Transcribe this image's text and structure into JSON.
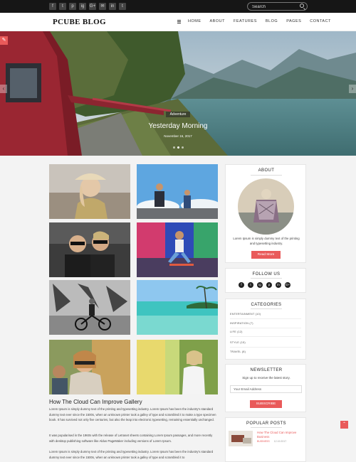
{
  "topbar": {
    "social": [
      "f",
      "t",
      "p",
      "ig",
      "G+",
      "✉",
      "in",
      "t"
    ],
    "search_placeholder": "Search"
  },
  "header": {
    "logo": "PCUBE BLOG",
    "nav": [
      "HOME",
      "ABOUT",
      "FEATURES",
      "BLOG",
      "PAGES",
      "CONTACT"
    ]
  },
  "hero": {
    "category": "Adventure",
    "title": "Yesterday Morning",
    "date": "November 16, 2017"
  },
  "post": {
    "title": "How The Cloud Can Improve Gallery",
    "para1": "Lorem Ipsum is simply dummy text of the printing and typesetting industry. Lorem Ipsum has been the industry's standard dummy text ever since the 1500s, when an unknown printer took a galley of type and scrambled it to make a type specimen book. It has survived not only five centuries, but also the leap into electronic typesetting, remaining essentially unchanged.",
    "para2": "It was popularised in the 1960s with the release of Letraset sheets containing Lorem Ipsum passages, and more recently with desktop publishing software like Aldus PageMaker including versions of Lorem Ipsum.",
    "para3": "Lorem Ipsum is simply dummy text of the printing and typesetting industry. Lorem Ipsum has been the industry's standard dummy text ever since the 1500s, when an unknown printer took a galley of type and scrambled it to"
  },
  "sidebar": {
    "about": {
      "title": "ABOUT",
      "text": "Lorem Ipsum is simply dummy text of the printing and typesetting industry.",
      "button": "Read More"
    },
    "follow": {
      "title": "FOLLOW US",
      "icons": [
        "f",
        "t",
        "ig",
        "p",
        "in",
        "G+"
      ]
    },
    "categories": {
      "title": "CATEGORIES",
      "items": [
        "ENTERTAINMENT (10)",
        "INSPIRATION (7)",
        "LIFE (12)",
        "STYLE (15)",
        "TRAVEL (8)"
      ]
    },
    "newsletter": {
      "title": "NEWSLETTER",
      "text": "Sign up to receive the latest story.",
      "placeholder": "Your Email Address",
      "button": "SUBSCRIBE"
    },
    "popular": {
      "title": "POPULAR POSTS",
      "post_title": "How The Cloud Can Improve Business",
      "post_category": "BUSINESS",
      "post_date": "12.19.2017"
    }
  },
  "colors": {
    "accent": "#e95a5a",
    "topbar": "#161616"
  }
}
